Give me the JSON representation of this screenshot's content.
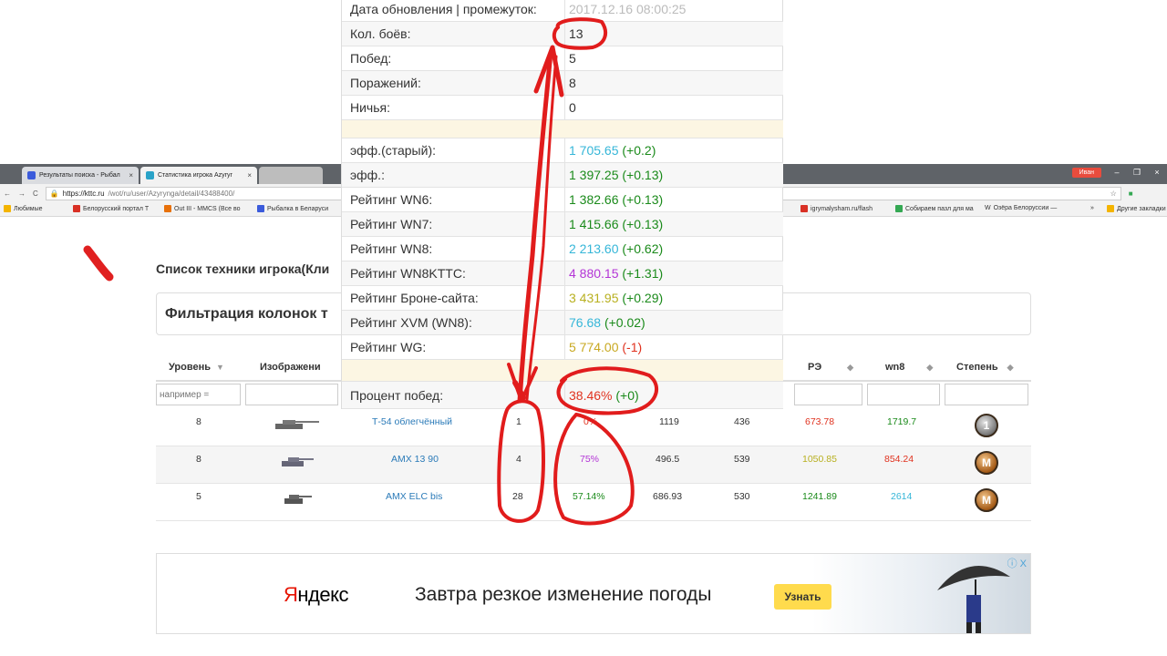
{
  "browser": {
    "tabs": [
      {
        "label": "Результаты поиска - Рыбал",
        "color": "#3b5bdb"
      },
      {
        "label": "Статистика игрока Azyryr",
        "color": "#2aa3c8"
      }
    ],
    "user_chip": "Иван",
    "win_min": "–",
    "win_max": "❐",
    "win_close": "×",
    "address": {
      "host": "https://kttc.ru",
      "path": "/wot/ru/user/Azyrynga/detail/43488400/"
    },
    "bookmarks": [
      {
        "label": "Любимые",
        "color": "#f4b400"
      },
      {
        "label": "Белорусский портал Т",
        "color": "#d93025"
      },
      {
        "label": "Out III - MMCS (Все во",
        "color": "#e8710a"
      },
      {
        "label": "Рыбалка в Беларуси",
        "color": "#3b5bdb"
      },
      {
        "label": "igrymalysham.ru/flash",
        "color": "#d93025"
      },
      {
        "label": "Собираем пазл для ма",
        "color": "#34a853"
      },
      {
        "label": "Озёра Белоруссии —",
        "color": "#777777"
      },
      {
        "label": "»",
        "color": ""
      },
      {
        "label": "Другие закладки",
        "color": "#f4b400"
      }
    ],
    "wiki_letter": "W"
  },
  "page": {
    "title": "Список техники игрока(Кли",
    "filter_title": "Фильтрация колонок т"
  },
  "table": {
    "headers": [
      {
        "label": "Уровень",
        "sort": "▼"
      },
      {
        "label": "Изображени",
        "sort": ""
      },
      {
        "label": "РЭ",
        "sort": "◆"
      },
      {
        "label": "wn8",
        "sort": "◆"
      },
      {
        "label": "Степень",
        "sort": "◆"
      }
    ],
    "filter_placeholder": "например = ",
    "rows": [
      {
        "level": "8",
        "name": "Т-54 облегчённый",
        "battles": "1",
        "winrate": "0%",
        "dmg": "1119",
        "col6": "436",
        "re": "673.78",
        "wn8": "1719.7",
        "medal": "1",
        "re_color": "#e0321f",
        "wn8_color": "#1a8a1a",
        "win_color": "#e0321f"
      },
      {
        "level": "8",
        "name": "AMX 13 90",
        "battles": "4",
        "winrate": "75%",
        "dmg": "496.5",
        "col6": "539",
        "re": "1050.85",
        "wn8": "854.24",
        "medal": "M",
        "re_color": "#b8b020",
        "wn8_color": "#e0321f",
        "win_color": "#b335d6"
      },
      {
        "level": "5",
        "name": "AMX ELC bis",
        "battles": "28",
        "winrate": "57.14%",
        "dmg": "686.93",
        "col6": "530",
        "re": "1241.89",
        "wn8": "2614",
        "medal": "M",
        "re_color": "#1a8a1a",
        "wn8_color": "#35b6d8",
        "win_color": "#1a8a1a"
      }
    ]
  },
  "ad": {
    "logo_y": "Я",
    "logo_rest": "ндекс",
    "text": "Завтра резкое изменение погоды",
    "button": "Узнать",
    "close": "ⓘ X"
  },
  "stats": {
    "rows": [
      {
        "label": "Дата обновления | промежуток:",
        "value": "2017.12.16 08:00:25",
        "delta": "",
        "vcls": "c-gray",
        "dcls": ""
      },
      {
        "label": "Кол. боёв:",
        "value": "13",
        "delta": "",
        "vcls": "",
        "dcls": ""
      },
      {
        "label": "Побед:",
        "value": "5",
        "delta": "",
        "vcls": "",
        "dcls": ""
      },
      {
        "label": "Поражений:",
        "value": "8",
        "delta": "",
        "vcls": "",
        "dcls": ""
      },
      {
        "label": "Ничья:",
        "value": "0",
        "delta": "",
        "vcls": "",
        "dcls": ""
      },
      {
        "label": "",
        "value": "",
        "delta": "",
        "vcls": "",
        "dcls": ""
      },
      {
        "label": "эфф.(старый):",
        "value": "1 705.65",
        "delta": "(+0.2)",
        "vcls": "c-cyan",
        "dcls": "c-green"
      },
      {
        "label": "эфф.:",
        "value": "1 397.25",
        "delta": "(+0.13)",
        "vcls": "c-green",
        "dcls": "c-green"
      },
      {
        "label": "Рейтинг WN6:",
        "value": "1 382.66",
        "delta": "(+0.13)",
        "vcls": "c-green",
        "dcls": "c-green"
      },
      {
        "label": "Рейтинг WN7:",
        "value": "1 415.66",
        "delta": "(+0.13)",
        "vcls": "c-green",
        "dcls": "c-green"
      },
      {
        "label": "Рейтинг WN8:",
        "value": "2 213.60",
        "delta": "(+0.62)",
        "vcls": "c-cyan",
        "dcls": "c-green"
      },
      {
        "label": "Рейтинг WN8KTTC:",
        "value": "4 880.15",
        "delta": "(+1.31)",
        "vcls": "c-purple",
        "dcls": "c-green"
      },
      {
        "label": "Рейтинг Броне-сайта:",
        "value": "3 431.95",
        "delta": "(+0.29)",
        "vcls": "c-olive",
        "dcls": "c-green"
      },
      {
        "label": "Рейтинг XVM (WN8):",
        "value": "76.68",
        "delta": "(+0.02)",
        "vcls": "c-cyan",
        "dcls": "c-green"
      },
      {
        "label": "Рейтинг WG:",
        "value": "5 774.00",
        "delta": "(-1)",
        "vcls": "c-orange",
        "dcls": "c-red"
      },
      {
        "label": "",
        "value": "",
        "delta": "",
        "vcls": "",
        "dcls": ""
      },
      {
        "label": "Процент побед:",
        "value": "38.46%",
        "delta": "(+0)",
        "vcls": "c-red",
        "dcls": "c-green"
      }
    ]
  }
}
